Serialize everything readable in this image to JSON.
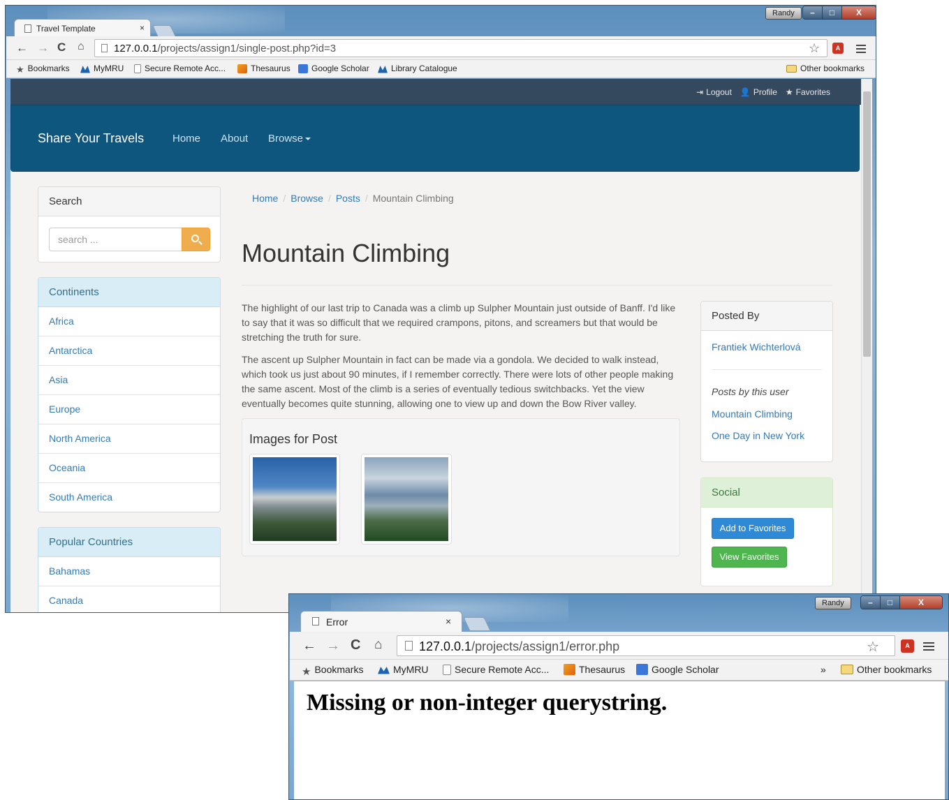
{
  "window1": {
    "user_label": "Randy",
    "tab_title": "Travel Template",
    "url_host": "127.0.0.1",
    "url_path": "/projects/assign1/single-post.php?id=3",
    "bookmarks": [
      "Bookmarks",
      "MyMRU",
      "Secure Remote Acc...",
      "Thesaurus",
      "Google Scholar",
      "Library Catalogue"
    ],
    "other_bookmarks": "Other bookmarks"
  },
  "site": {
    "top_links": {
      "logout": "Logout",
      "profile": "Profile",
      "favorites": "Favorites"
    },
    "brand": "Share Your Travels",
    "nav": {
      "home": "Home",
      "about": "About",
      "browse": "Browse"
    },
    "search": {
      "heading": "Search",
      "placeholder": "search ..."
    },
    "continents": {
      "heading": "Continents",
      "items": [
        "Africa",
        "Antarctica",
        "Asia",
        "Europe",
        "North America",
        "Oceania",
        "South America"
      ]
    },
    "countries": {
      "heading": "Popular Countries",
      "items": [
        "Bahamas",
        "Canada"
      ]
    },
    "breadcrumb": {
      "home": "Home",
      "browse": "Browse",
      "posts": "Posts",
      "current": "Mountain Climbing",
      "sep": "/"
    },
    "post": {
      "title": "Mountain Climbing",
      "para1": "The highlight of our last trip to Canada was a climb up Sulpher Mountain just outside of Banff. I'd like to say that it was so difficult that we required crampons, pitons, and screamers  but that would be stretching the truth for sure.",
      "para2": "The ascent up Sulpher Mountain in fact can be made via a gondola. We decided to walk instead, which took us just about 90 minutes, if I remember correctly. There were lots of other people making the same ascent. Most of the climb is a series of eventually tedious switchbacks. Yet the view eventually becomes quite stunning, allowing one to view up and down the Bow River valley.",
      "images_heading": "Images for Post"
    },
    "posted_by": {
      "heading": "Posted By",
      "author": "Frantiek Wichterlová",
      "posts_label": "Posts by this user",
      "posts": [
        "Mountain Climbing",
        "One Day in New York"
      ]
    },
    "social": {
      "heading": "Social",
      "add_favorites": "Add to Favorites",
      "view_favorites": "View Favorites"
    }
  },
  "window2": {
    "user_label": "Randy",
    "tab_title": "Error",
    "url_host": "127.0.0.1",
    "url_path": "/projects/assign1/error.php",
    "bookmarks": [
      "Bookmarks",
      "MyMRU",
      "Secure Remote Acc...",
      "Thesaurus",
      "Google Scholar"
    ],
    "more": "»",
    "other_bookmarks": "Other bookmarks",
    "message": "Missing or non-integer querystring."
  },
  "window_controls": {
    "minimize": "–",
    "maximize": "□",
    "close": "X"
  }
}
